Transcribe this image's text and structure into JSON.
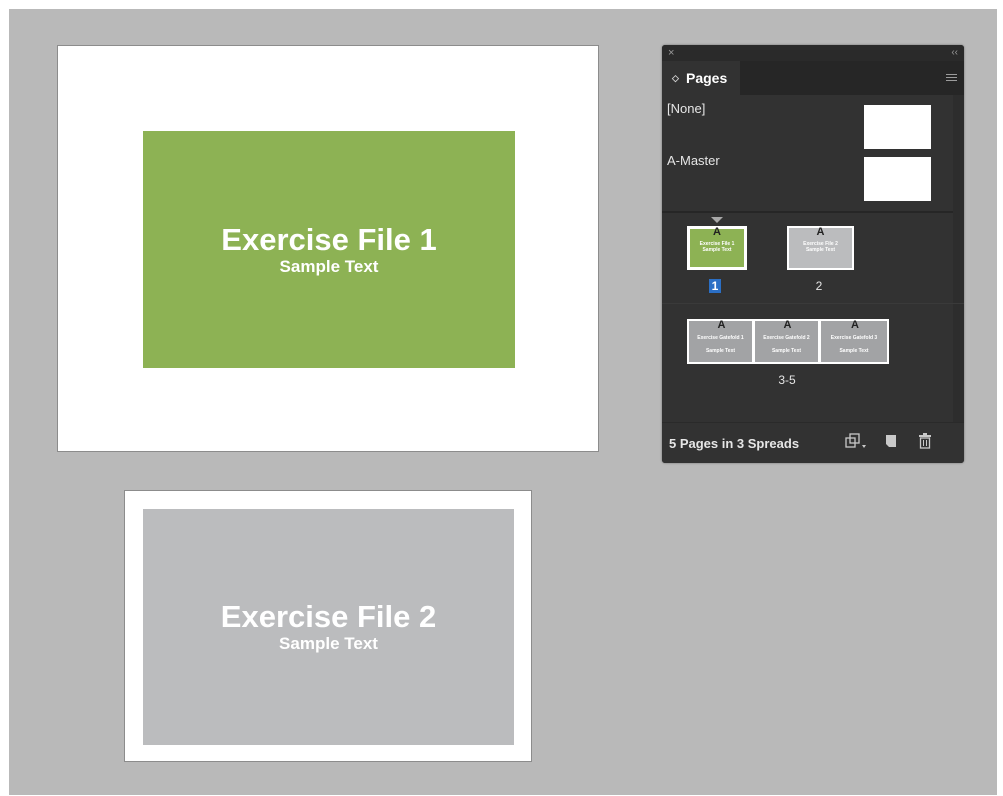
{
  "document": {
    "page1": {
      "title": "Exercise File 1",
      "subtitle": "Sample Text",
      "block_color": "#8db254"
    },
    "page2": {
      "title": "Exercise File 2",
      "subtitle": "Sample Text",
      "block_color": "#bbbcbe"
    }
  },
  "panel": {
    "close_icon": "×",
    "collapse_icon": "‹‹",
    "tab_arrows": "◇",
    "tab_label": "Pages",
    "masters": [
      {
        "label": "[None]"
      },
      {
        "label": "A-Master"
      }
    ],
    "thumb_master_letter": "A",
    "page_thumbs": [
      {
        "title": "Exercise File 1",
        "subtitle": "Sample Text",
        "number": "1",
        "selected": true
      },
      {
        "title": "Exercise File 2",
        "subtitle": "Sample Text",
        "number": "2"
      }
    ],
    "spread_thumbs": [
      {
        "title": "Exercise Gatefold 1",
        "subtitle": "Sample Text"
      },
      {
        "title": "Exercise Gatefold 2",
        "subtitle": "Sample Text"
      },
      {
        "title": "Exercise Gatefold 3",
        "subtitle": "Sample Text"
      }
    ],
    "spread_label": "3-5",
    "status": "5 Pages in 3 Spreads",
    "icons": [
      "edit-page-size-icon",
      "new-page-icon",
      "trash-icon"
    ]
  }
}
